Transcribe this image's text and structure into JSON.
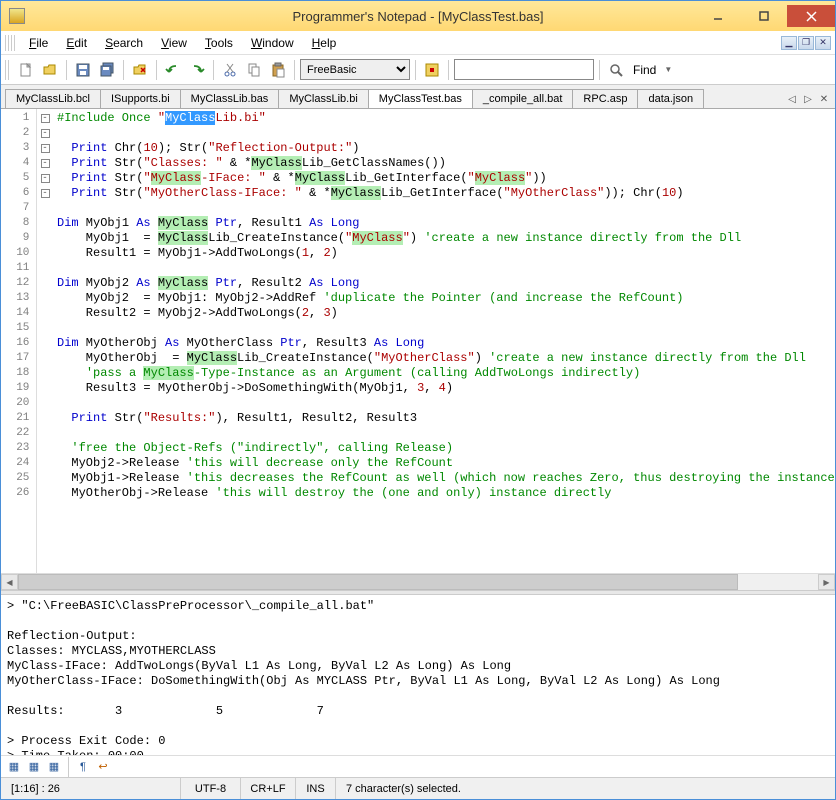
{
  "window": {
    "title": "Programmer's Notepad - [MyClassTest.bas]"
  },
  "menu": {
    "items": [
      "File",
      "Edit",
      "Search",
      "View",
      "Tools",
      "Window",
      "Help"
    ]
  },
  "toolbar": {
    "language_combo": "FreeBasic",
    "find_input": "",
    "find_label": "Find"
  },
  "tabs": {
    "items": [
      "MyClassLib.bcl",
      "ISupports.bi",
      "MyClassLib.bas",
      "MyClassLib.bi",
      "MyClassTest.bas",
      "_compile_all.bat",
      "RPC.asp",
      "data.json"
    ],
    "active_index": 4
  },
  "editor": {
    "line_count": 26,
    "selection": "MyClass",
    "lines": "code body rendered in template"
  },
  "output": {
    "text": "> \"C:\\FreeBASIC\\ClassPreProcessor\\_compile_all.bat\"\n\nReflection-Output:\nClasses: MYCLASS,MYOTHERCLASS\nMyClass-IFace: AddTwoLongs(ByVal L1 As Long, ByVal L2 As Long) As Long\nMyOtherClass-IFace: DoSomethingWith(Obj As MYCLASS Ptr, ByVal L1 As Long, ByVal L2 As Long) As Long\n\nResults:       3             5             7\n\n> Process Exit Code: 0\n> Time Taken: 00:00\n"
  },
  "status": {
    "position": "[1:16] : 26",
    "encoding": "UTF-8",
    "lineending": "CR+LF",
    "mode": "INS",
    "message": "7 character(s) selected."
  }
}
